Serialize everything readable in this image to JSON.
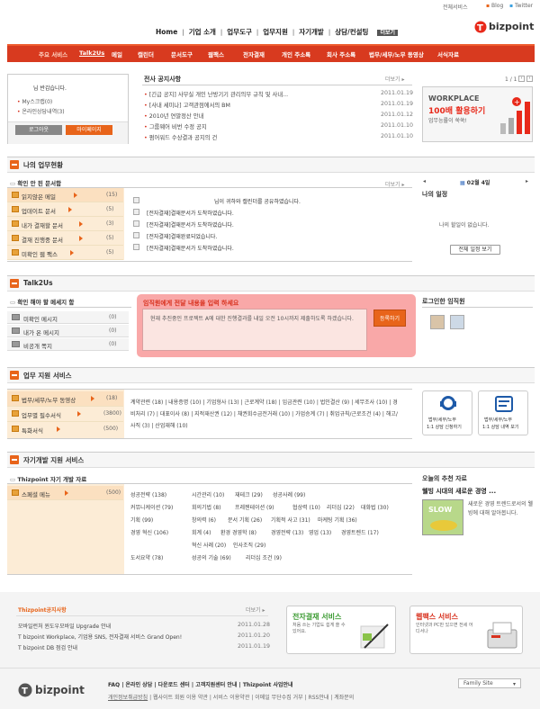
{
  "util": {
    "items": [
      "전체서비스",
      "Blog",
      "Twitter"
    ]
  },
  "logo": {
    "text": "bizpoint"
  },
  "topnav": [
    "Home",
    "기업 소개",
    "업무도구",
    "업무지원",
    "자기개발",
    "상담/컨설팅",
    "더보기"
  ],
  "menubar": {
    "label": "주요 서비스",
    "current": "Talk2Us",
    "items": [
      "메일",
      "캘린더",
      "문서도구",
      "웹팩스",
      "전자결재",
      "개인 주소록",
      "회사 주소록",
      "법무/세무/노무 동영상",
      "서식자료"
    ]
  },
  "login": {
    "greeting": "님 반갑습니다.",
    "links": [
      "My스크랩(0)",
      "온라인상담내역(3)"
    ],
    "btn_logout": "로그아웃",
    "btn_mypage": "마이페이지"
  },
  "notice": {
    "title": "전사 공지사항",
    "more": "더보기",
    "items": [
      {
        "text": "[긴급 공지] 사무실 개인 난방기기 관리의무 규칙 및 사내...",
        "date": "2011.01.19"
      },
      {
        "text": "[사내 세미나] 고객관점에서의 BM",
        "date": "2011.01.19"
      },
      {
        "text": "2010년 연말정산 안내",
        "date": "2011.01.12"
      },
      {
        "text": "그룹웨어 비번 수정 공지",
        "date": "2011.01.10"
      },
      {
        "text": "펌어워드 수상결과 공지의 건",
        "date": "2011.01.10"
      }
    ]
  },
  "banner": {
    "pager": "1 / 1",
    "title1": "WORKPLACE",
    "title2": "100배 활용하기",
    "sub": "업무능률이 쑥쑥!"
  },
  "work": {
    "title": "나의 업무현황",
    "box_title": "확인 안 된 문서함",
    "more": "더보기",
    "rows": [
      {
        "label": "읽지않은 메일",
        "count": "(15)"
      },
      {
        "label": "업데이트 문서",
        "count": "(5)"
      },
      {
        "label": "내가 결재할 문서",
        "count": "(3)"
      },
      {
        "label": "결재 진행중 문서",
        "count": "(5)"
      },
      {
        "label": "미확인 웹 팩스",
        "count": "(5)"
      }
    ],
    "msgs": [
      "님이 귀하와 캘린더를 공유하였습니다.",
      "[전자결재]결재문서가 도착하였습니다.",
      "[전자결재]결재문서가 도착하였습니다.",
      "[전자결재]결재완료되었습니다.",
      "[전자결재]결재문서가 도착하였습니다."
    ],
    "cal_date": "02월 4일",
    "schedule_title": "나의 일정",
    "no_schedule": "나의 할일이 없습니다.",
    "btn_schedule": "전체 일정 보기"
  },
  "talk": {
    "title": "Talk2Us",
    "box_title": "확인 해야 할 메세지 함",
    "rows": [
      {
        "label": "미확인 메시지",
        "count": "(0)"
      },
      {
        "label": "내가 온 메시지",
        "count": "(0)"
      },
      {
        "label": "비공개 쪽지",
        "count": "(0)"
      }
    ],
    "compose_title": "임직원에게 전달 내용을 입력 하세요",
    "compose_text": "현재 추진중인 프로젝트 A에 대한 진행결과를 내일 오전 10시까지 제출하도록 하겠습니다.",
    "btn_send": "등록하기",
    "online_title": "로그인한 임직원"
  },
  "support": {
    "title": "업무 지원 서비스",
    "rows": [
      {
        "label": "법무/세무/노무 동영상",
        "count": "(18)"
      },
      {
        "label": "업무별 필수서식",
        "count": "(3800)"
      },
      {
        "label": "특화서식",
        "count": "(500)"
      }
    ],
    "links": [
      "계약관련 (18)",
      "내용증명 (10)",
      "기업형사 (13)",
      "근로계약 (18)",
      "임금관련 (10)",
      "법인결산 (9)",
      "세무조사 (10)",
      "경비처리 (7)",
      "대표이사 (8)",
      "지적재산권 (12)",
      "채권회수금전거래 (10)",
      "가업승계 (7)",
      "취업규칙/근로조건 (4)",
      "해고/사직 (3)",
      "산업재해 (10)"
    ],
    "btn1": [
      "법무/세무/노무",
      "1:1 상담 신청하기"
    ],
    "btn2": [
      "법무/세무/노무",
      "1:1 상담 내역 보기"
    ]
  },
  "dev": {
    "title": "자기개발 지원 서비스",
    "box_title": "Thizpoint 자기 개발 자료",
    "row": {
      "label": "스페셜 메뉴",
      "count": "(500)"
    },
    "links": [
      "성공전략 (138)",
      "시간관리 (10)",
      "재테크 (29)",
      "성공사례 (99)",
      "커뮤니케이션 (79)",
      "회의기법 (8)",
      "프레젠테이션 (9)",
      "협상력 (10)",
      "리더십 (22)",
      "대화법 (30)",
      "기획 (99)",
      "창의력 (6)",
      "문서 기획 (26)",
      "기획적 사고 (31)",
      "마케팅 기획 (36)",
      "경영 혁신 (106)",
      "회계 (4)",
      "환경 경영학 (8)",
      "경영전략 (13)",
      "영업 (13)",
      "경영트렌드 (17)",
      "혁신 사례 (20)",
      "인사조직 (29)",
      "도서요약 (78)",
      "성공의 기술 (69)",
      "리더십 조건 (9)"
    ],
    "rec_title": "오늘의 추천 자료",
    "rec_head": "웰빙 시대의 새로운 경영 ...",
    "rec_text": "새로운 경영 트렌드로서의 웰빙에 대해 알아봅니다.",
    "rec_img": "SLOW"
  },
  "footer_notice": {
    "title": "Thizpoint공지사항",
    "more": "더보기",
    "items": [
      {
        "text": "모바일런처 윈도우모바일 Upgrade 안내",
        "date": "2011.01.28"
      },
      {
        "text": "T bizpoint Workplace, 기업용 SNS, 전자결재 서비스 Grand Open!",
        "date": "2011.01.20"
      },
      {
        "text": "T bizpoint DB 점검 안내",
        "date": "2011.01.19"
      }
    ]
  },
  "promo1": {
    "title": "전자결재 서비스",
    "sub": "처음 쓰는 기업도 쉽게 쓸 수 있어요."
  },
  "promo2": {
    "title": "웹팩스 서비스",
    "sub": "인터넷과 PC만 있으면 전세 어디서나"
  },
  "footer": {
    "logo": "bizpoint",
    "links": [
      "FAQ",
      "온라인 상담",
      "다운로드 센터",
      "고객지원센터 안내",
      "Thizpoint 사업안내"
    ],
    "links2": [
      "개인정보취급방침",
      "웹사이트 회원 이용 약관",
      "서비스 이용약관",
      "이메일 무단수집 거부",
      "RSS안내",
      "계좌문의"
    ],
    "family": "Family Site"
  },
  "colors": {
    "accent": "#e8641a",
    "menubar": "#d83a1f",
    "highlight": "#f9a8a8"
  }
}
